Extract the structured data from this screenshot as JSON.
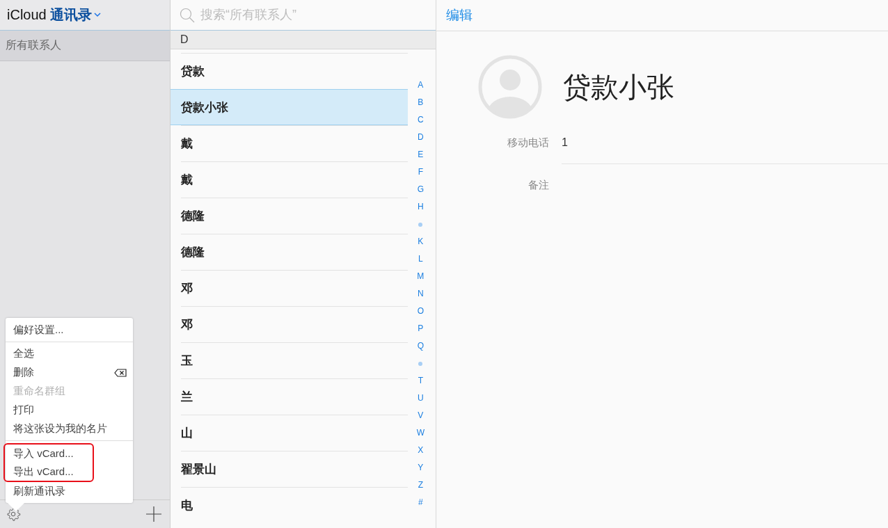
{
  "sidebar": {
    "account": "iCloud",
    "title": "通讯录",
    "groups": [
      {
        "label": "所有联系人",
        "selected": true
      }
    ]
  },
  "menu": {
    "sections": [
      [
        {
          "label": "偏好设置...",
          "disabled": false,
          "annotated": false
        }
      ],
      [
        {
          "label": "全选",
          "disabled": false,
          "annotated": false
        },
        {
          "label": "删除",
          "disabled": false,
          "annotated": false,
          "kind": "delete"
        },
        {
          "label": "重命名群组",
          "disabled": true,
          "annotated": false
        },
        {
          "label": "打印",
          "disabled": false,
          "annotated": false
        },
        {
          "label": "将这张设为我的名片",
          "disabled": false,
          "annotated": false
        }
      ],
      [
        {
          "label": "导入 vCard...",
          "disabled": false,
          "annotated": true
        },
        {
          "label": "导出 vCard...",
          "disabled": false,
          "annotated": true
        },
        {
          "label": "刷新通讯录",
          "disabled": false,
          "annotated": false
        }
      ]
    ]
  },
  "search": {
    "placeholder": "搜索“所有联系人”"
  },
  "list": {
    "section": "D",
    "contacts": [
      {
        "name": "贷款",
        "selected": false
      },
      {
        "name": "贷款小张",
        "selected": true
      },
      {
        "name": "戴",
        "selected": false
      },
      {
        "name": "戴",
        "selected": false
      },
      {
        "name": "德隆",
        "selected": false
      },
      {
        "name": "德隆",
        "selected": false
      },
      {
        "name": "邓",
        "selected": false
      },
      {
        "name": "邓",
        "selected": false
      },
      {
        "name": "玉",
        "selected": false
      },
      {
        "name": "兰",
        "selected": false
      },
      {
        "name": "山",
        "selected": false
      },
      {
        "name": "翟景山",
        "selected": false
      },
      {
        "name": "电",
        "selected": false
      }
    ],
    "index": [
      {
        "kind": "letter",
        "label": "A"
      },
      {
        "kind": "letter",
        "label": "B"
      },
      {
        "kind": "letter",
        "label": "C"
      },
      {
        "kind": "letter",
        "label": "D"
      },
      {
        "kind": "letter",
        "label": "E"
      },
      {
        "kind": "letter",
        "label": "F"
      },
      {
        "kind": "letter",
        "label": "G"
      },
      {
        "kind": "letter",
        "label": "H"
      },
      {
        "kind": "dot"
      },
      {
        "kind": "letter",
        "label": "K"
      },
      {
        "kind": "letter",
        "label": "L"
      },
      {
        "kind": "letter",
        "label": "M"
      },
      {
        "kind": "letter",
        "label": "N"
      },
      {
        "kind": "letter",
        "label": "O"
      },
      {
        "kind": "letter",
        "label": "P"
      },
      {
        "kind": "letter",
        "label": "Q"
      },
      {
        "kind": "dot"
      },
      {
        "kind": "letter",
        "label": "T"
      },
      {
        "kind": "letter",
        "label": "U"
      },
      {
        "kind": "letter",
        "label": "V"
      },
      {
        "kind": "letter",
        "label": "W"
      },
      {
        "kind": "letter",
        "label": "X"
      },
      {
        "kind": "letter",
        "label": "Y"
      },
      {
        "kind": "letter",
        "label": "Z"
      },
      {
        "kind": "letter",
        "label": "#"
      }
    ]
  },
  "detail": {
    "edit": "编辑",
    "name": "贷款小张",
    "fields": [
      {
        "label": "移动电话",
        "value": "1"
      },
      {
        "label": "备注"
      }
    ]
  }
}
